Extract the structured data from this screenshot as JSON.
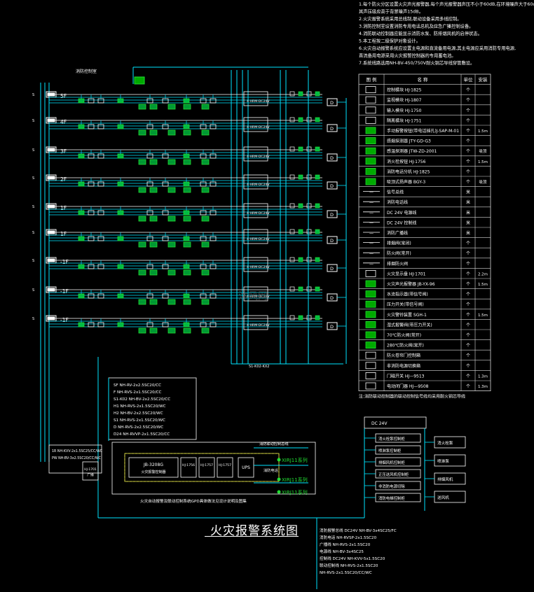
{
  "title": "火灾报警系统图",
  "watermark": "沐风网",
  "colors": {
    "background": "#000000",
    "cyan": "#00e5ff",
    "green": "#22dd33",
    "white": "#ffffff",
    "yellow": "#e8e84a",
    "grid": "#d8d8d8"
  },
  "notes": [
    "1.每个防火分区设置火灾声光报警器,每个声光报警器声压不小于60dB,在环境噪声大于60dB的场所",
    "  其声压级应高于背景噪声15dB。",
    "2.火灾报警系统采用总线制,联动设备采用多线控制。",
    "3.消防控制室设置消防专用电话总机及应急广播控制设备。",
    "4.消防联动控制器应能显示消防水泵、防排烟风机的启停状态。",
    "5.本工程按二级保护对象设计。",
    "6.火灾自动报警系统应设置主电源和直流备用电源,其主电源应采用消防专用电源,",
    "  直流备用电源采用火灾报警控制器的专用蓄电池。",
    "7.系统线路选用NH-BV-450/750V耐火铜芯导线穿管敷设。"
  ],
  "floors": [
    "5F",
    "4F",
    "3F",
    "2F",
    "1F",
    "1F",
    "-1F",
    "-1F",
    "-1F"
  ],
  "legend": {
    "headers": [
      "图 例",
      "名 称",
      "单位",
      "安装"
    ],
    "rows": [
      {
        "name": "控制模块  HJ-1825",
        "unit": "个",
        "mount": ""
      },
      {
        "name": "监视模块  HJ-1807",
        "unit": "个",
        "mount": ""
      },
      {
        "name": "输入模块  HJ-1750",
        "unit": "个",
        "mount": ""
      },
      {
        "name": "隔离模块  HJ-1751",
        "unit": "个",
        "mount": ""
      },
      {
        "name": "手动报警按钮(带电话插孔)J-SAP-M-01",
        "unit": "个",
        "mount": "1.5m"
      },
      {
        "name": "感烟探测器  JTY-GD-G3",
        "unit": "个",
        "mount": ""
      },
      {
        "name": "感温探测器  JTW-ZD-2001",
        "unit": "个",
        "mount": "吸顶"
      },
      {
        "name": "消火栓按钮  HJ-1756",
        "unit": "个",
        "mount": "1.5m"
      },
      {
        "name": "消防电话分机  HJ-1825",
        "unit": "个",
        "mount": ""
      },
      {
        "name": "吸顶式扬声器  BGY-3",
        "unit": "个",
        "mount": "吸顶"
      },
      {
        "name": "信号总线",
        "unit": "米",
        "mount": ""
      },
      {
        "name": "消防电话线",
        "unit": "米",
        "mount": ""
      },
      {
        "name": "DC 24V 电源线",
        "unit": "米",
        "mount": ""
      },
      {
        "name": "DC 24V 控制线",
        "unit": "米",
        "mount": ""
      },
      {
        "name": "消防广播线",
        "unit": "米",
        "mount": ""
      },
      {
        "name": "排烟阀(常闭)",
        "unit": "个",
        "mount": ""
      },
      {
        "name": "防火阀(常开)",
        "unit": "个",
        "mount": ""
      },
      {
        "name": "排烟防火阀",
        "unit": "个",
        "mount": ""
      },
      {
        "name": "火灾显示盘  HJ-1701",
        "unit": "个",
        "mount": "2.2m"
      },
      {
        "name": "火灾声光报警器  JB-YX-96",
        "unit": "个",
        "mount": "1.5m"
      },
      {
        "name": "水流指示器(带信号阀)",
        "unit": "个",
        "mount": ""
      },
      {
        "name": "压力开关(带信号阀)",
        "unit": "个",
        "mount": ""
      },
      {
        "name": "火灾警铃装置  SGH-1",
        "unit": "个",
        "mount": "1.5m"
      },
      {
        "name": "湿式报警阀(带压力开关)",
        "unit": "个",
        "mount": ""
      },
      {
        "name": "70℃防火阀(常开)",
        "unit": "个",
        "mount": ""
      },
      {
        "name": "280℃防火阀(常开)",
        "unit": "个",
        "mount": ""
      },
      {
        "name": "防火卷帘门控制箱",
        "unit": "个",
        "mount": ""
      },
      {
        "name": "非消防电源切换箱",
        "unit": "个",
        "mount": ""
      },
      {
        "name": "门磁开关  HJ—9513",
        "unit": "个",
        "mount": "1.3m"
      },
      {
        "name": "电动闭门器  HJ—9508",
        "unit": "个",
        "mount": "1.3m"
      }
    ],
    "footnote": "注:消防联动控制器的联动控制信号线均采用耐火铜芯导线"
  },
  "cable_notes_left": [
    "SF  NH-RV-2x2.5SC20/CC",
    "F   NH-RVS-2x1.5SC20/CC",
    "S1-K02  NH-BV-2x2.5SC20/CC",
    "H1  NH-RVS-2x1.5SC20/WC",
    "H2  NH-BV-2x2.5SC20/WC",
    "S1  NH-RVS-2x1.5SC20/WC",
    "D   NH-RVS-2x2.5SC20/WC",
    "D24 NH-RVVP-2x1.5SC20/CC"
  ],
  "cable_notes_bottom": [
    "消防报警总线 DC24V  NH-BV-3x4SC25/FC",
    "消防电话 NH-RVSP-2x1.5SC20",
    "广播线 NH-RVS-2x1.5SC20",
    "电源线 NH-BV-3x4SC25",
    "控制线 DC24V  NH-KVV-5x1.5SC20",
    "联动控制线 NH-RVS-2x1.5SC20",
    "NH-RVS-2x1.5SC20/CC/WC"
  ],
  "control_room": {
    "main": "JB-3208G 火灾报警控制器(联动型)",
    "sub1": "HJ-1756",
    "sub2": "HJ-1757",
    "sub3": "HJ-1757",
    "psu": "UPS",
    "left_box": "HJ-1701 消防广播",
    "room_label": "火灾自动报警及联动控制系统GPD具体做法见设计说明及图集",
    "x1": "XIRJ11系列",
    "x2": "XIRJ11系列",
    "x3": "XIRJ11系列",
    "fire_phone": "消防电话",
    "bus_label": "消防联动控制总线"
  },
  "right_boxes": [
    "DC 24V",
    "消火栓泵控制柜",
    "喷淋泵控制柜",
    "排烟风机控制柜",
    "正压送风机控制柜",
    "非消防电源切除",
    "消防电梯控制柜"
  ],
  "right_small_boxes": [
    "消火栓泵",
    "喷淋泵",
    "排烟风机",
    "送风机"
  ],
  "top_label": "消防控制室",
  "module_label": "4-HRM-DC24V",
  "cabinet_label": "S1-K02-KX2"
}
